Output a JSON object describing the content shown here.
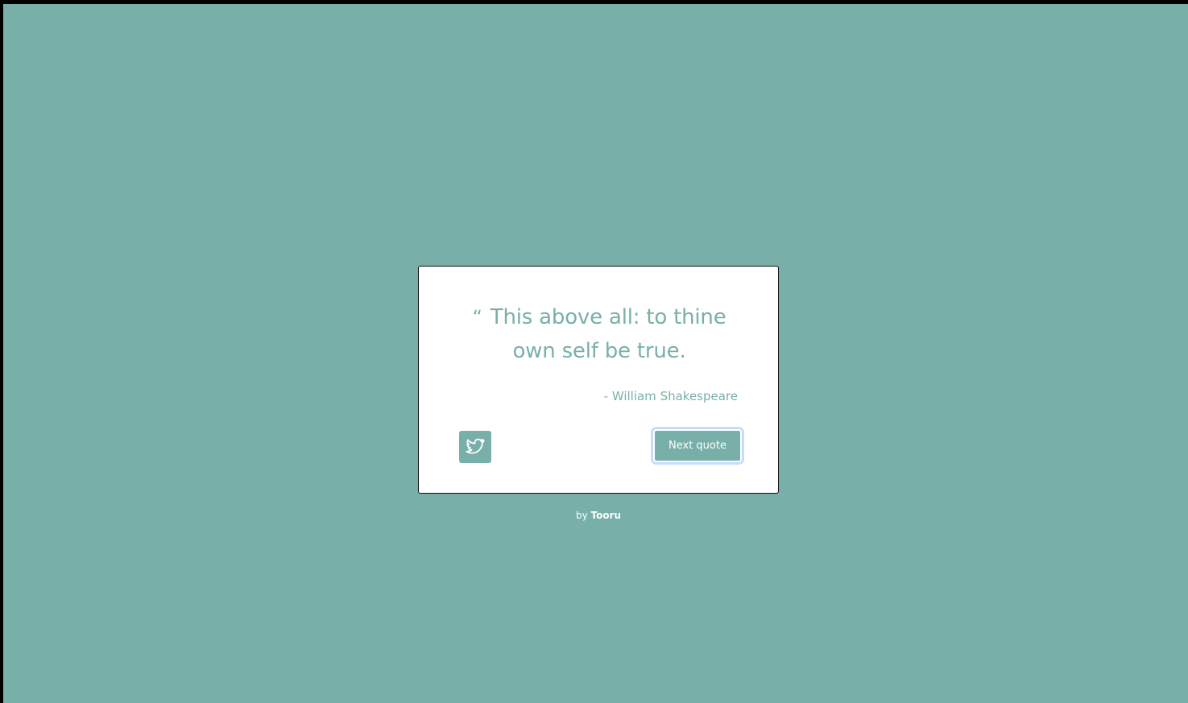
{
  "colors": {
    "background": "#78b0a9",
    "card": "#ffffff",
    "accent": "#78b0a9",
    "focus_ring": "#c6dcff"
  },
  "quote": {
    "mark": "“",
    "text": "This above all: to thine own self be true.",
    "author": "- William Shakespeare"
  },
  "actions": {
    "tweet_icon": "twitter-bird-icon",
    "next_label": "Next quote"
  },
  "footer": {
    "prefix": "by",
    "author": "Tooru"
  }
}
